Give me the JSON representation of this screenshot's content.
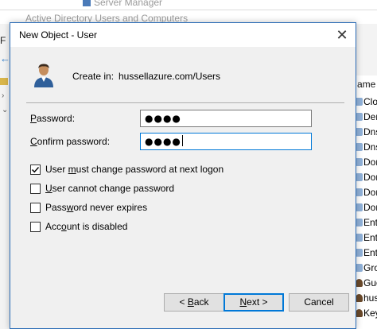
{
  "background": {
    "top_title": "Server Manager",
    "window_title": "Active Directory Users and Computers",
    "menu_first": "F",
    "list_header": "ame",
    "list_items": [
      "Clo",
      "Der",
      "Dns",
      "Dns",
      "Don",
      "Don",
      "Don",
      "Don",
      "Ente",
      "Ente",
      "Ente",
      "Gro",
      "Gue",
      "hus",
      "Key"
    ]
  },
  "dialog": {
    "title": "New Object - User",
    "close_glyph": "✕",
    "create_in_label": "Create in:",
    "create_in_value": "hussellazure.com/Users",
    "password_label_u": "P",
    "password_label_rest": "assword:",
    "password_value": "●●●●",
    "confirm_label_u": "C",
    "confirm_label_rest": "onfirm password:",
    "confirm_value": "●●●●",
    "checkboxes": [
      {
        "pre": "User ",
        "u": "m",
        "post": "ust change password at next logon",
        "checked": true
      },
      {
        "pre": "",
        "u": "U",
        "post": "ser cannot change password",
        "checked": false
      },
      {
        "pre": "Pass",
        "u": "w",
        "post": "ord never expires",
        "checked": false
      },
      {
        "pre": "Acc",
        "u": "o",
        "post": "unt is disabled",
        "checked": false
      }
    ],
    "buttons": {
      "back_pre": "< ",
      "back_u": "B",
      "back_post": "ack",
      "next_u": "N",
      "next_post": "ext >",
      "cancel": "Cancel"
    }
  },
  "colors": {
    "accent": "#0078d7",
    "dialog_border": "#2b6cb6",
    "dialog_bg": "#f0f0f0"
  },
  "icons": [
    "user-icon",
    "close-icon",
    "checkmark-icon",
    "folder-icon",
    "back-arrow-icon"
  ]
}
